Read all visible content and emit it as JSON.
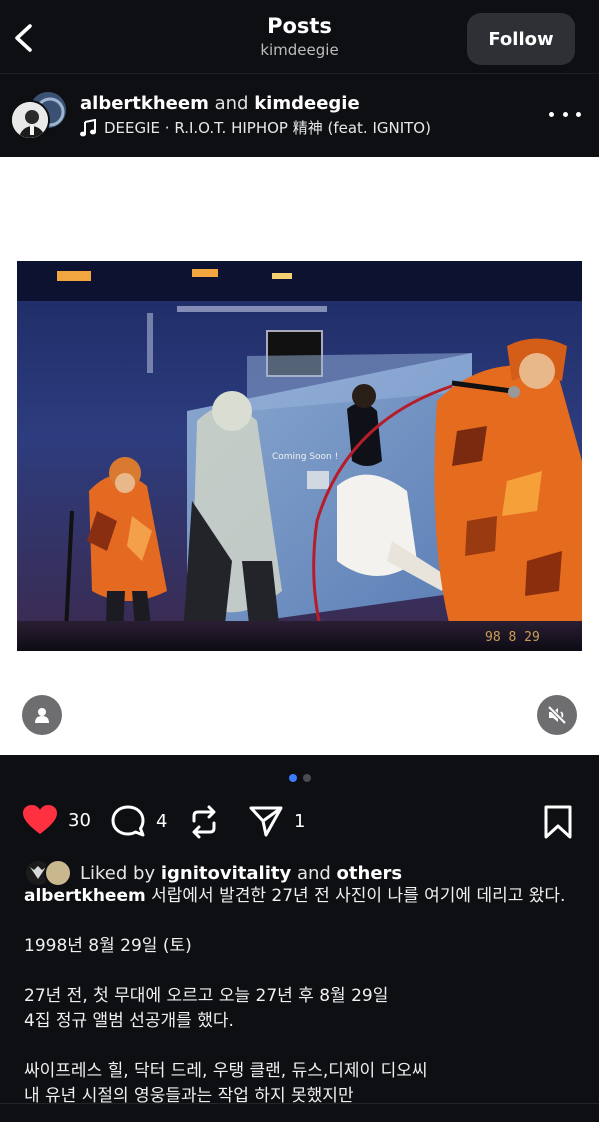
{
  "header": {
    "title": "Posts",
    "subtitle": "kimdeegie",
    "follow_label": "Follow"
  },
  "post": {
    "author_primary": "albertkheem",
    "author_join": "and",
    "author_secondary": "kimdeegie",
    "music_text": "DEEGIE · R.I.O.T. HIPHOP 精神 (feat. IGNITO)",
    "photo_overlay_text": "Coming Soon !",
    "photo_date_stamp": "98 8 29"
  },
  "carousel": {
    "total": 2,
    "active": 1
  },
  "actions": {
    "likes": "30",
    "comments": "4",
    "shares": "1"
  },
  "liked_by": {
    "prefix": "Liked by",
    "user": "ignitovitality",
    "join": "and",
    "suffix": "others"
  },
  "caption": {
    "user": "albertkheem",
    "first_line": "서랍에서 발견한 27년 전 사진이 나를 여기에 데리고 왔다.",
    "lines": [
      "",
      "1998년 8월 29일 (토)",
      "",
      "27년 전, 첫 무대에 오르고 오늘 27년 후 8월 29일",
      "4집 정규 앨범 선공개를 했다.",
      "",
      "싸이프레스 힐, 닥터 드레, 우탱 클랜, 듀스,디제이 디오씨",
      "내 유년 시절의 영웅들과는 작업 하지 못했지만"
    ]
  },
  "colors": {
    "background": "#0e0f12",
    "like_red": "#ff3040",
    "active_dot": "#3b7bff"
  },
  "icons": [
    "back-icon",
    "more-icon",
    "music-note-icon",
    "user-tag-icon",
    "volume-mute-icon",
    "heart-icon",
    "comment-icon",
    "repost-icon",
    "send-icon",
    "bookmark-icon"
  ]
}
